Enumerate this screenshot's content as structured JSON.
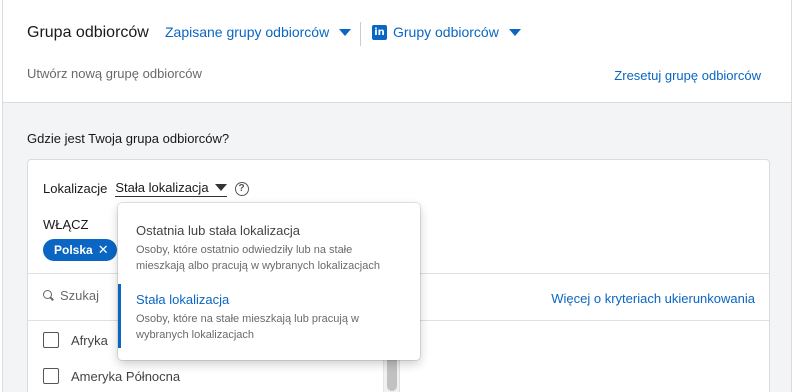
{
  "header": {
    "title": "Grupa odbiorców",
    "saved_groups_label": "Zapisane grupy odbiorców",
    "li_logo": "in",
    "groups_label": "Grupy odbiorców",
    "subtitle": "Utwórz nową grupę odbiorców",
    "reset_label": "Zresetuj grupę odbiorców"
  },
  "section": {
    "question": "Gdzie jest Twoja grupa odbiorców?"
  },
  "location": {
    "label": "Lokalizacje",
    "selected": "Stała lokalizacja",
    "help_glyph": "?",
    "include_label": "WŁĄCZ",
    "chips": [
      {
        "label": "Polska"
      }
    ],
    "chip_remove_glyph": "✕",
    "search_placeholder": "Szukaj",
    "more_criteria_label": "Więcej o kryteriach ukierunkowania",
    "list": [
      {
        "label": "Afryka",
        "checked": false
      },
      {
        "label": "Ameryka Północna",
        "checked": false
      }
    ]
  },
  "dropdown": {
    "options": [
      {
        "title": "Ostatnia lub stała lokalizacja",
        "desc": "Osoby, które ostatnio odwiedziły lub na stałe mieszkają albo pracują w wybranych lokalizacjach",
        "selected": false
      },
      {
        "title": "Stała lokalizacja",
        "desc": "Osoby, które na stałe mieszkają lub pracują w wybranych lokalizacjach",
        "selected": true
      }
    ]
  },
  "colors": {
    "accent": "#0a66c2",
    "background": "#f3f4f5"
  }
}
